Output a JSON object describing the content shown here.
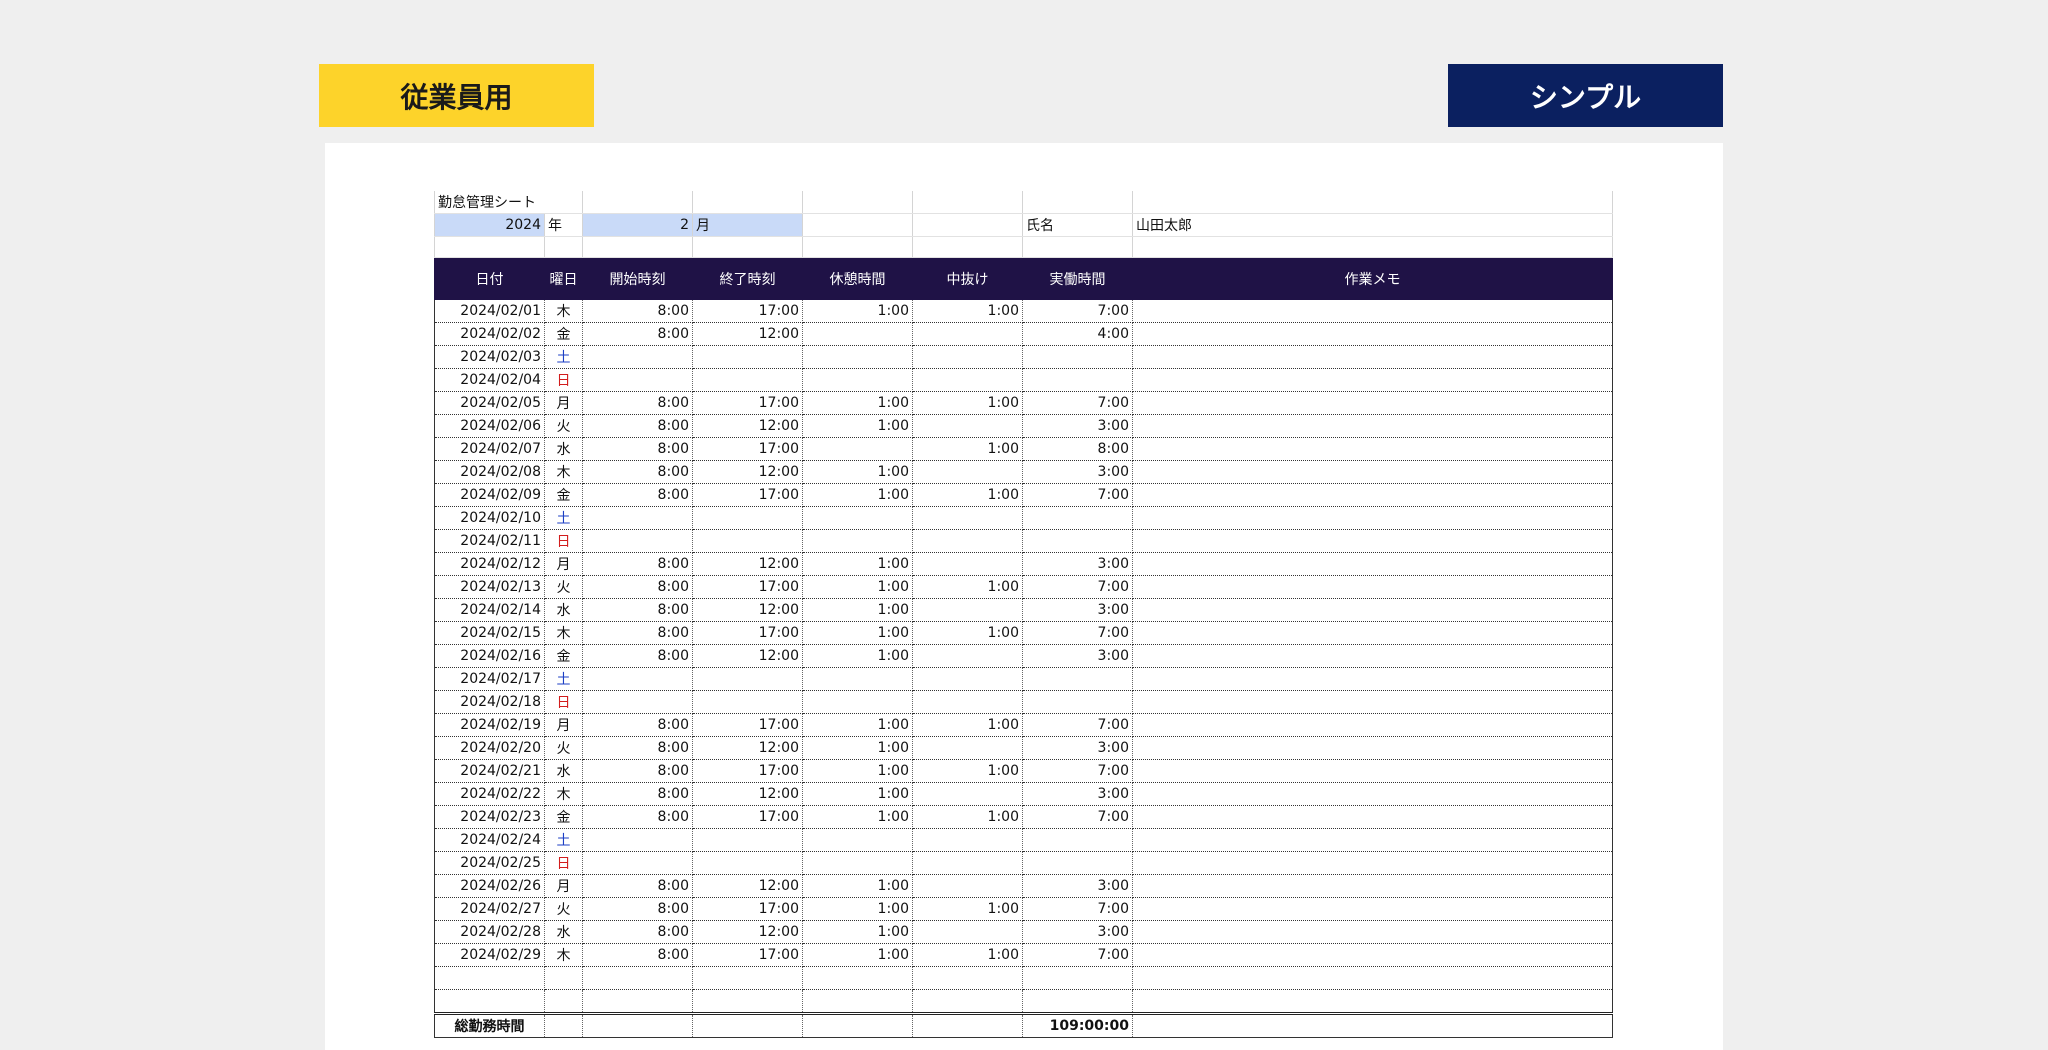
{
  "tags": {
    "employee": "従業員用",
    "style": "シンプル"
  },
  "sheet": {
    "title": "勤怠管理シート",
    "year": "2024",
    "year_unit": "年",
    "month": "2",
    "month_unit": "月",
    "name_label": "氏名",
    "name": "山田太郎",
    "headers": [
      "日付",
      "曜日",
      "開始時刻",
      "終了時刻",
      "休憩時間",
      "中抜け",
      "実働時間",
      "作業メモ"
    ],
    "rows": [
      {
        "date": "2024/02/01",
        "day": "木",
        "start": "8:00",
        "end": "17:00",
        "break": "1:00",
        "away": "1:00",
        "work": "7:00"
      },
      {
        "date": "2024/02/02",
        "day": "金",
        "start": "8:00",
        "end": "12:00",
        "break": "",
        "away": "",
        "work": "4:00"
      },
      {
        "date": "2024/02/03",
        "day": "土",
        "start": "",
        "end": "",
        "break": "",
        "away": "",
        "work": ""
      },
      {
        "date": "2024/02/04",
        "day": "日",
        "start": "",
        "end": "",
        "break": "",
        "away": "",
        "work": ""
      },
      {
        "date": "2024/02/05",
        "day": "月",
        "start": "8:00",
        "end": "17:00",
        "break": "1:00",
        "away": "1:00",
        "work": "7:00"
      },
      {
        "date": "2024/02/06",
        "day": "火",
        "start": "8:00",
        "end": "12:00",
        "break": "1:00",
        "away": "",
        "work": "3:00"
      },
      {
        "date": "2024/02/07",
        "day": "水",
        "start": "8:00",
        "end": "17:00",
        "break": "",
        "away": "1:00",
        "work": "8:00"
      },
      {
        "date": "2024/02/08",
        "day": "木",
        "start": "8:00",
        "end": "12:00",
        "break": "1:00",
        "away": "",
        "work": "3:00"
      },
      {
        "date": "2024/02/09",
        "day": "金",
        "start": "8:00",
        "end": "17:00",
        "break": "1:00",
        "away": "1:00",
        "work": "7:00"
      },
      {
        "date": "2024/02/10",
        "day": "土",
        "start": "",
        "end": "",
        "break": "",
        "away": "",
        "work": ""
      },
      {
        "date": "2024/02/11",
        "day": "日",
        "start": "",
        "end": "",
        "break": "",
        "away": "",
        "work": ""
      },
      {
        "date": "2024/02/12",
        "day": "月",
        "start": "8:00",
        "end": "12:00",
        "break": "1:00",
        "away": "",
        "work": "3:00"
      },
      {
        "date": "2024/02/13",
        "day": "火",
        "start": "8:00",
        "end": "17:00",
        "break": "1:00",
        "away": "1:00",
        "work": "7:00"
      },
      {
        "date": "2024/02/14",
        "day": "水",
        "start": "8:00",
        "end": "12:00",
        "break": "1:00",
        "away": "",
        "work": "3:00"
      },
      {
        "date": "2024/02/15",
        "day": "木",
        "start": "8:00",
        "end": "17:00",
        "break": "1:00",
        "away": "1:00",
        "work": "7:00"
      },
      {
        "date": "2024/02/16",
        "day": "金",
        "start": "8:00",
        "end": "12:00",
        "break": "1:00",
        "away": "",
        "work": "3:00"
      },
      {
        "date": "2024/02/17",
        "day": "土",
        "start": "",
        "end": "",
        "break": "",
        "away": "",
        "work": ""
      },
      {
        "date": "2024/02/18",
        "day": "日",
        "start": "",
        "end": "",
        "break": "",
        "away": "",
        "work": ""
      },
      {
        "date": "2024/02/19",
        "day": "月",
        "start": "8:00",
        "end": "17:00",
        "break": "1:00",
        "away": "1:00",
        "work": "7:00"
      },
      {
        "date": "2024/02/20",
        "day": "火",
        "start": "8:00",
        "end": "12:00",
        "break": "1:00",
        "away": "",
        "work": "3:00"
      },
      {
        "date": "2024/02/21",
        "day": "水",
        "start": "8:00",
        "end": "17:00",
        "break": "1:00",
        "away": "1:00",
        "work": "7:00"
      },
      {
        "date": "2024/02/22",
        "day": "木",
        "start": "8:00",
        "end": "12:00",
        "break": "1:00",
        "away": "",
        "work": "3:00"
      },
      {
        "date": "2024/02/23",
        "day": "金",
        "start": "8:00",
        "end": "17:00",
        "break": "1:00",
        "away": "1:00",
        "work": "7:00"
      },
      {
        "date": "2024/02/24",
        "day": "土",
        "start": "",
        "end": "",
        "break": "",
        "away": "",
        "work": ""
      },
      {
        "date": "2024/02/25",
        "day": "日",
        "start": "",
        "end": "",
        "break": "",
        "away": "",
        "work": ""
      },
      {
        "date": "2024/02/26",
        "day": "月",
        "start": "8:00",
        "end": "12:00",
        "break": "1:00",
        "away": "",
        "work": "3:00"
      },
      {
        "date": "2024/02/27",
        "day": "火",
        "start": "8:00",
        "end": "17:00",
        "break": "1:00",
        "away": "1:00",
        "work": "7:00"
      },
      {
        "date": "2024/02/28",
        "day": "水",
        "start": "8:00",
        "end": "12:00",
        "break": "1:00",
        "away": "",
        "work": "3:00"
      },
      {
        "date": "2024/02/29",
        "day": "木",
        "start": "8:00",
        "end": "17:00",
        "break": "1:00",
        "away": "1:00",
        "work": "7:00"
      }
    ],
    "total_label": "総勤務時間",
    "total_value": "109:00:00"
  }
}
